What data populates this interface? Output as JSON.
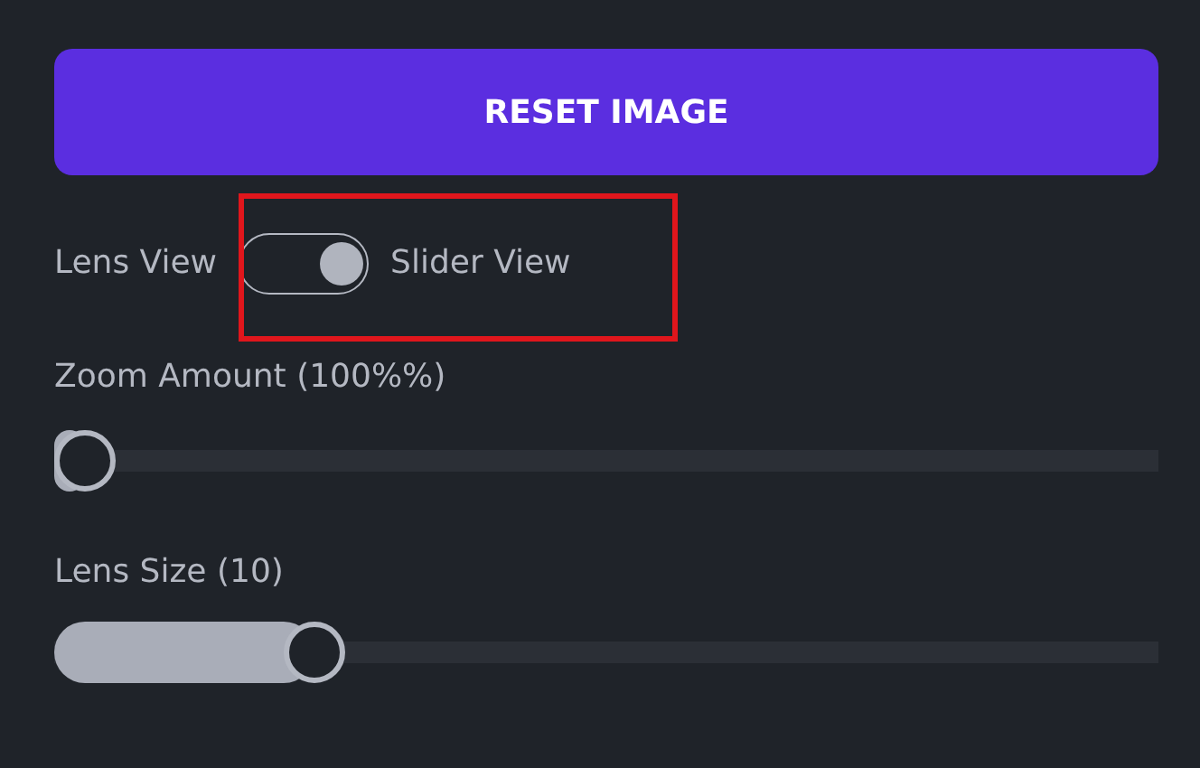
{
  "reset_button": {
    "label": "RESET IMAGE"
  },
  "view_toggle": {
    "left_label": "Lens View",
    "right_label": "Slider View",
    "on": true,
    "highlighted": true
  },
  "sliders": [
    {
      "label": "Zoom Amount (100%%)",
      "level": 0
    },
    {
      "label": "Lens Size (10)",
      "level": 0.22
    }
  ]
}
